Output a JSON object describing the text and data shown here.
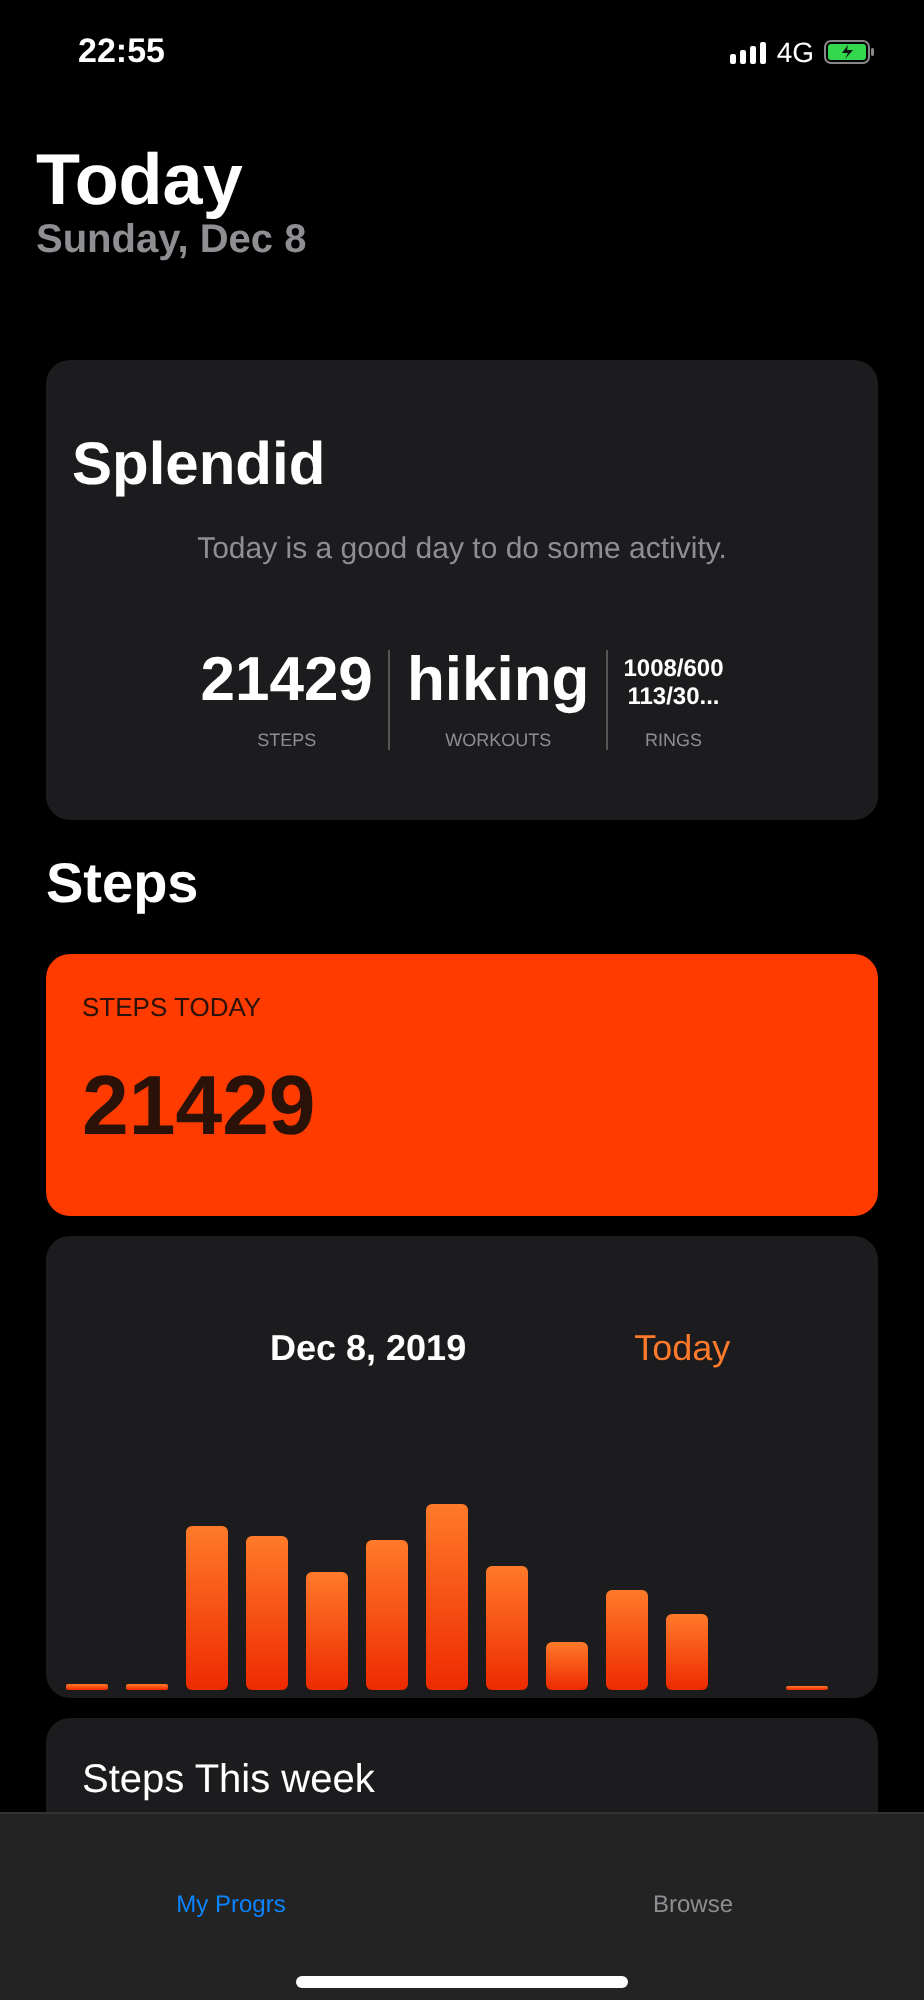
{
  "status_bar": {
    "time": "22:55",
    "network": "4G"
  },
  "header": {
    "title": "Today",
    "subtitle": "Sunday, Dec 8"
  },
  "summary_card": {
    "title": "Splendid",
    "message": "Today is a good day to do some activity.",
    "stats": [
      {
        "kind": "big",
        "value": "21429",
        "label": "STEPS"
      },
      {
        "kind": "big",
        "value": "hiking",
        "label": "WORKOUTS"
      },
      {
        "kind": "small",
        "value": "1008/600\n113/30...",
        "label": "RINGS"
      }
    ]
  },
  "steps_section": {
    "title": "Steps",
    "today_card": {
      "label": "STEPS TODAY",
      "value": "21429"
    }
  },
  "day_chart_card": {
    "date": "Dec 8, 2019",
    "link": "Today"
  },
  "week_card": {
    "title": "Steps This week"
  },
  "tab_bar": [
    {
      "label": "My Progrs",
      "selected": true
    },
    {
      "label": "Browse",
      "selected": false
    }
  ]
}
